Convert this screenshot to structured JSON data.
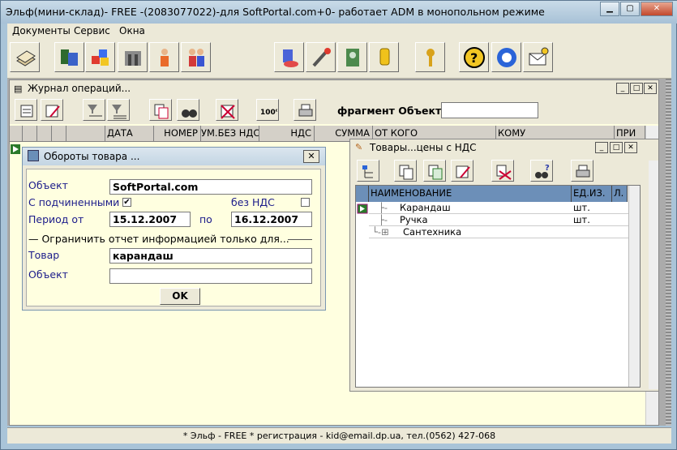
{
  "window": {
    "title": "Эльф(мини-склад)- FREE -(2083077022)-для SoftPortal.com+0- работает ADM в монопольном режиме"
  },
  "menu": [
    "Документы",
    "Сервис",
    "Окна"
  ],
  "journal": {
    "title": "Журнал операций...",
    "fragment_label": "фрагмент Объекта",
    "fragment_value": "",
    "columns": [
      "ДАТА",
      "НОМЕР",
      "УМ.БЕЗ НДС",
      "НДС",
      "СУММА",
      "ОТ КОГО",
      "КОМУ",
      "ПРИ"
    ]
  },
  "dialog": {
    "title": "Обороты товара ...",
    "object_label": "Объект",
    "object_value": "SoftPortal.com",
    "subordinate_label": "С подчиненными",
    "subordinate_check": "✔",
    "no_vat_label": "без НДС",
    "period_label": "Период от",
    "period_from": "15.12.2007",
    "period_to_label": "по",
    "period_to": "16.12.2007",
    "limit_label": "— Ограничить отчет информацией только для...",
    "goods_label": "Товар",
    "goods_value": "карандаш",
    "object2_label": "Объект",
    "object2_value": "",
    "ok_label": "OK"
  },
  "goods": {
    "title": "Товары...цены с НДС",
    "columns": [
      "НАИМЕНОВАНИЕ",
      "ЕД.ИЗ.",
      "Л."
    ],
    "rows": [
      {
        "name": "Карандаш",
        "unit": "шт."
      },
      {
        "name": "Ручка",
        "unit": "шт."
      },
      {
        "name": "Сантехника",
        "unit": ""
      }
    ]
  },
  "status": "* Эльф - FREE * регистрация - kid@email.dp.ua, тел.(0562) 427-068",
  "colors": {
    "accent": "#6c8fb8",
    "panel": "#ffffe0",
    "face": "#ece9d8"
  }
}
